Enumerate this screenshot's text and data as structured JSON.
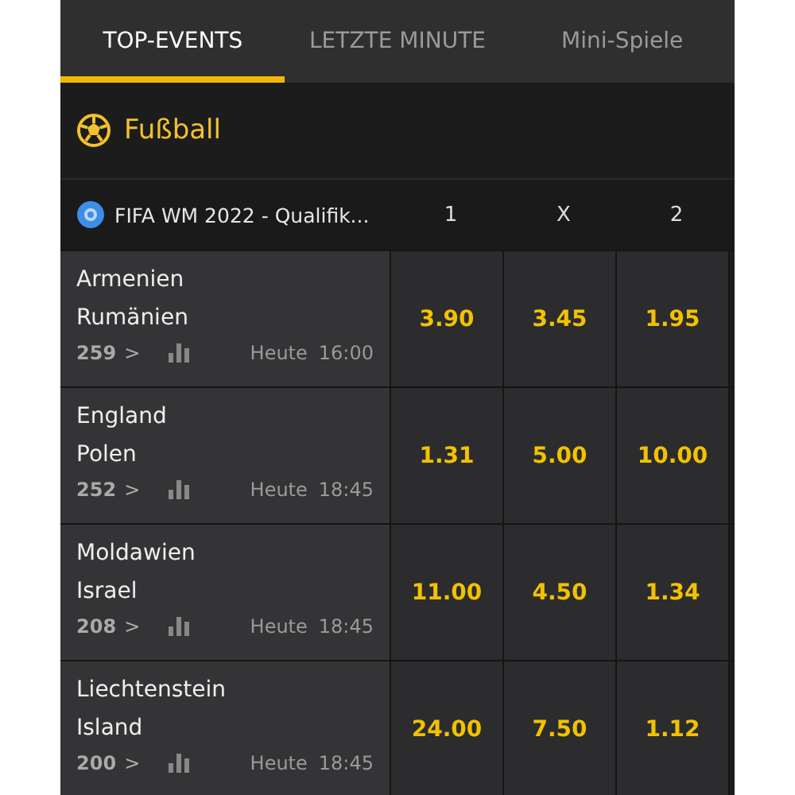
{
  "tabs": [
    {
      "label": "TOP-EVENTS",
      "selected": true
    },
    {
      "label": "LETZTE MINUTE",
      "selected": false
    },
    {
      "label": "Mini-Spiele",
      "selected": false
    }
  ],
  "sport": {
    "title": "Fußball"
  },
  "league": {
    "name": "FIFA WM 2022 - Qualifik...",
    "columns": [
      "1",
      "X",
      "2"
    ]
  },
  "matches": [
    {
      "home": "Armenien",
      "away": "Rumänien",
      "markets": "259",
      "chevron": ">",
      "day": "Heute",
      "time": "16:00",
      "odds": [
        "3.90",
        "3.45",
        "1.95"
      ]
    },
    {
      "home": "England",
      "away": "Polen",
      "markets": "252",
      "chevron": ">",
      "day": "Heute",
      "time": "18:45",
      "odds": [
        "1.31",
        "5.00",
        "10.00"
      ]
    },
    {
      "home": "Moldawien",
      "away": "Israel",
      "markets": "208",
      "chevron": ">",
      "day": "Heute",
      "time": "18:45",
      "odds": [
        "11.00",
        "4.50",
        "1.34"
      ]
    },
    {
      "home": "Liechtenstein",
      "away": "Island",
      "markets": "200",
      "chevron": ">",
      "day": "Heute",
      "time": "18:45",
      "odds": [
        "24.00",
        "7.50",
        "1.12"
      ]
    }
  ]
}
